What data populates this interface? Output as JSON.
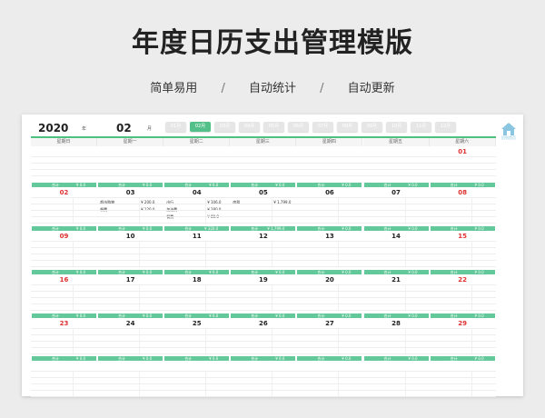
{
  "header": {
    "title": "年度日历支出管理模版",
    "tags": [
      "简单易用",
      "自动统计",
      "自动更新"
    ],
    "separator": "/"
  },
  "calendar": {
    "year": "2020",
    "year_unit": "年",
    "month": "02",
    "month_unit": "月",
    "home_label": "回到首页",
    "months": [
      "01月",
      "02月",
      "03月",
      "04月",
      "05月",
      "06月",
      "07月",
      "08月",
      "09月",
      "10月",
      "11月",
      "12月"
    ],
    "active_month_index": 1,
    "weekdays": [
      "星期日",
      "星期一",
      "星期二",
      "星期三",
      "星期四",
      "星期五",
      "星期六"
    ],
    "week1_dates": [
      "",
      "",
      "",
      "",
      "",
      "",
      "01"
    ],
    "weeks": [
      {
        "dates": [
          "02",
          "03",
          "04",
          "05",
          "06",
          "07",
          "08"
        ],
        "totals": [
          "¥ 0.0",
          "¥ 0.0",
          "¥ 0.0",
          "¥ 0.0",
          "¥ 0.0",
          "¥ 0.0",
          "¥ 0.0"
        ],
        "items": [
          [],
          [
            {
              "name": "超市购物",
              "amount": "¥ 200.0"
            },
            {
              "name": "餐费",
              "amount": "¥ 120.0"
            }
          ],
          [
            {
              "name": "出行",
              "amount": "¥ 106.0"
            },
            {
              "name": "加油费",
              "amount": "¥ 280.0"
            },
            {
              "name": "餐费",
              "amount": "¥ 80.0"
            }
          ],
          [
            {
              "name": "房租",
              "amount": "¥ 1,799.0"
            }
          ],
          [],
          [],
          []
        ]
      },
      {
        "dates": [
          "09",
          "10",
          "11",
          "12",
          "13",
          "14",
          "15"
        ],
        "totals": [
          "¥ 0.0",
          "¥ 0.0",
          "¥ 320.0",
          "¥ 1,799.0",
          "¥ 0.0",
          "¥ 0.0",
          "¥ 0.0"
        ],
        "items": [
          [],
          [],
          [],
          [],
          [],
          [],
          []
        ]
      },
      {
        "dates": [
          "16",
          "17",
          "18",
          "19",
          "20",
          "21",
          "22"
        ],
        "totals": [
          "¥ 0.0",
          "¥ 0.0",
          "¥ 0.0",
          "¥ 0.0",
          "¥ 0.0",
          "¥ 0.0",
          "¥ 0.0"
        ],
        "items": [
          [],
          [],
          [],
          [],
          [],
          [],
          []
        ]
      },
      {
        "dates": [
          "23",
          "24",
          "25",
          "26",
          "27",
          "28",
          "29"
        ],
        "totals": [
          "¥ 0.0",
          "¥ 0.0",
          "¥ 0.0",
          "¥ 0.0",
          "¥ 0.0",
          "¥ 0.0",
          "¥ 0.0"
        ],
        "items": [
          [],
          [],
          [],
          [],
          [],
          [],
          []
        ]
      },
      {
        "dates": [
          "",
          "",
          "",
          "",
          "",
          "",
          ""
        ],
        "totals": [
          "¥ 0.0",
          "¥ 0.0",
          "¥ 0.0",
          "¥ 0.0",
          "¥ 0.0",
          "¥ 0.0",
          "¥ 0.0"
        ],
        "items": [
          [],
          [],
          [],
          [],
          [],
          [],
          []
        ]
      }
    ],
    "total_label": "合计",
    "colors": {
      "accent": "#52c088",
      "sunday_sat": "#e03030",
      "home_icon": "#8ac6e0"
    }
  }
}
